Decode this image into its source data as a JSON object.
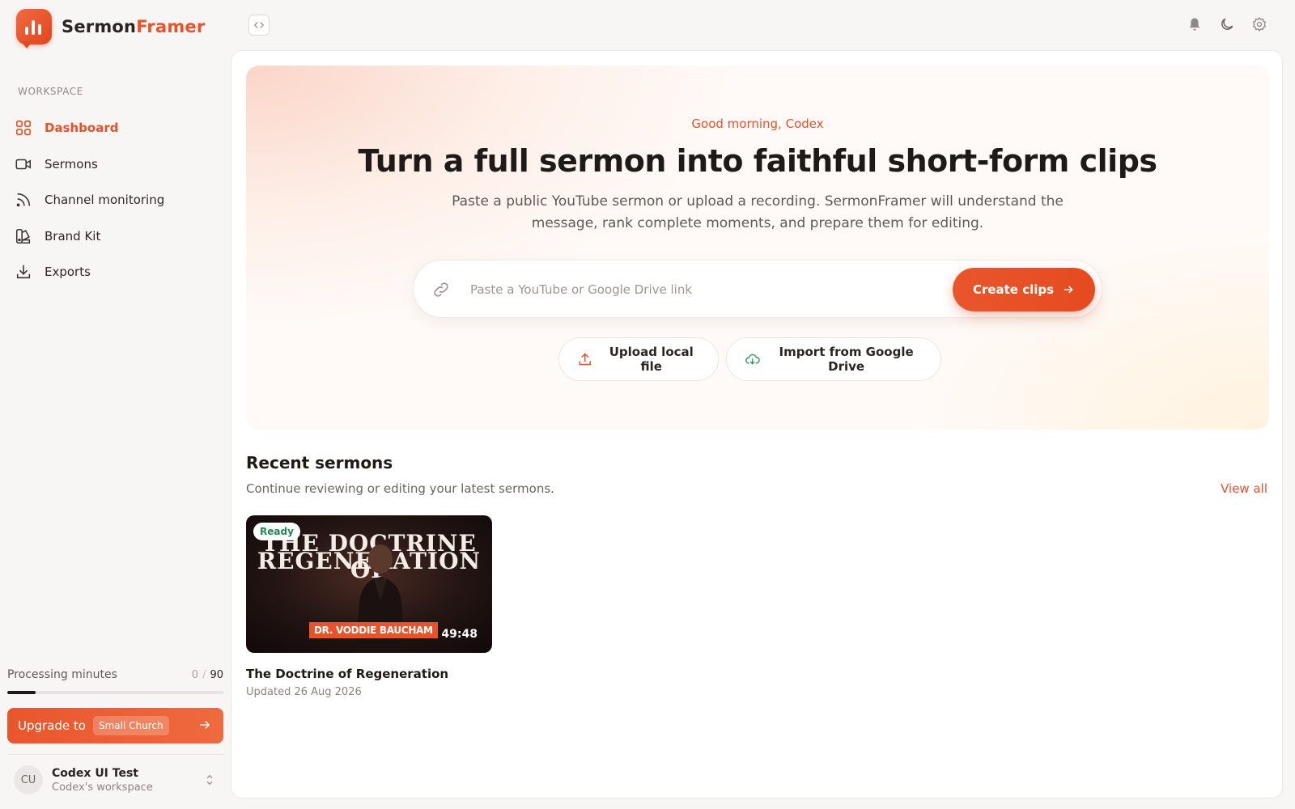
{
  "app": {
    "name_part1": "Sermon",
    "name_part2": "Framer",
    "accent": "#e5512a"
  },
  "sidebar": {
    "section_label": "WORKSPACE",
    "items": [
      {
        "label": "Dashboard",
        "icon": "grid-icon",
        "active": true
      },
      {
        "label": "Sermons",
        "icon": "video-icon",
        "active": false
      },
      {
        "label": "Channel monitoring",
        "icon": "rss-icon",
        "active": false
      },
      {
        "label": "Brand Kit",
        "icon": "palette-icon",
        "active": false
      },
      {
        "label": "Exports",
        "icon": "download-icon",
        "active": false
      }
    ],
    "processing": {
      "label": "Processing minutes",
      "used": "0",
      "separator": "/",
      "total": "90",
      "progress_fraction": 0.13
    },
    "upgrade": {
      "label": "Upgrade to",
      "plan": "Small Church"
    },
    "user": {
      "initials": "CU",
      "name": "Codex UI Test",
      "workspace": "Codex's workspace"
    }
  },
  "topbar": {
    "icons": [
      "code-icon",
      "bell-icon",
      "moon-icon",
      "gear-icon"
    ]
  },
  "hero": {
    "greeting": "Good morning, Codex",
    "headline": "Turn a full sermon into faithful short-form clips",
    "subtext": "Paste a public YouTube sermon or upload a recording. SermonFramer will understand the message, rank complete moments, and prepare them for editing.",
    "link_placeholder": "Paste a YouTube or Google Drive link",
    "link_value": "",
    "create_label": "Create clips",
    "upload_label": "Upload local file",
    "drive_label": "Import from Google Drive"
  },
  "recent": {
    "title": "Recent sermons",
    "subtitle": "Continue reviewing or editing your latest sermons.",
    "view_all": "View all",
    "items": [
      {
        "status": "Ready",
        "thumb_line1": "THE DOCTRINE OF",
        "thumb_line2": "REGENERATION",
        "speaker": "DR. VODDIE BAUCHAM",
        "duration": "49:48",
        "title": "The Doctrine of Regeneration",
        "updated": "Updated 26 Aug 2026"
      }
    ]
  }
}
